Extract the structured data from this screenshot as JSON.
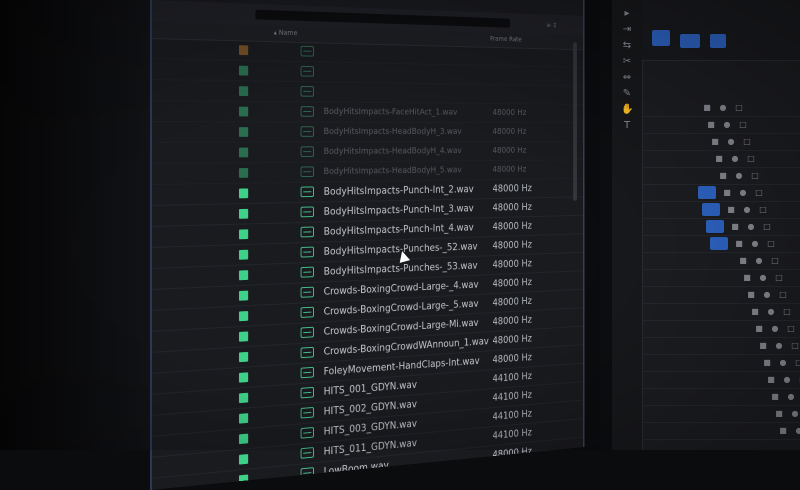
{
  "project_panel": {
    "sort_label": "≡ ↕",
    "header": {
      "name": "▴ Name",
      "rate": "Frame Rate"
    },
    "rows": [
      {
        "name": "",
        "rate": "",
        "dim": true
      },
      {
        "name": "",
        "rate": "",
        "dim": true
      },
      {
        "name": "",
        "rate": "",
        "dim": true
      },
      {
        "name": "BodyHitsImpacts-FaceHitAct_1.wav",
        "rate": "48000 Hz",
        "dim": true
      },
      {
        "name": "BodyHitsImpacts-HeadBodyH_3.wav",
        "rate": "48000 Hz",
        "dim": true
      },
      {
        "name": "BodyHitsImpacts-HeadBodyH_4.wav",
        "rate": "48000 Hz",
        "dim": true
      },
      {
        "name": "BodyHitsImpacts-HeadBodyH_5.wav",
        "rate": "48000 Hz",
        "dim": true
      },
      {
        "name": "BodyHitsImpacts-Punch-Int_2.wav",
        "rate": "48000 Hz",
        "dim": false
      },
      {
        "name": "BodyHitsImpacts-Punch-Int_3.wav",
        "rate": "48000 Hz",
        "dim": false
      },
      {
        "name": "BodyHitsImpacts-Punch-Int_4.wav",
        "rate": "48000 Hz",
        "dim": false
      },
      {
        "name": "BodyHitsImpacts-Punches-_52.wav",
        "rate": "48000 Hz",
        "dim": false
      },
      {
        "name": "BodyHitsImpacts-Punches-_53.wav",
        "rate": "48000 Hz",
        "dim": false
      },
      {
        "name": "Crowds-BoxingCrowd-Large-_4.wav",
        "rate": "48000 Hz",
        "dim": false
      },
      {
        "name": "Crowds-BoxingCrowd-Large-_5.wav",
        "rate": "48000 Hz",
        "dim": false
      },
      {
        "name": "Crowds-BoxingCrowd-Large-Mi.wav",
        "rate": "48000 Hz",
        "dim": false
      },
      {
        "name": "Crowds-BoxingCrowdWAnnoun_1.wav",
        "rate": "48000 Hz",
        "dim": false
      },
      {
        "name": "FoleyMovement-HandClaps-Int.wav",
        "rate": "48000 Hz",
        "dim": false
      },
      {
        "name": "HITS_001_GDYN.wav",
        "rate": "44100 Hz",
        "dim": false
      },
      {
        "name": "HITS_002_GDYN.wav",
        "rate": "44100 Hz",
        "dim": false
      },
      {
        "name": "HITS_003_GDYN.wav",
        "rate": "44100 Hz",
        "dim": false
      },
      {
        "name": "HITS_011_GDYN.wav",
        "rate": "44100 Hz",
        "dim": false
      },
      {
        "name": "LowBoom.wav",
        "rate": "48000 Hz",
        "dim": false
      }
    ]
  },
  "colors": {
    "label_green": "#3fd08a",
    "label_orange": "#e0922f",
    "panel_border": "#2c3a58",
    "track_blue": "#2f66c8"
  },
  "tools": [
    "selection-icon",
    "track-select-icon",
    "ripple-edit-icon",
    "razor-icon",
    "slip-icon",
    "pen-icon",
    "hand-icon",
    "type-icon"
  ],
  "right_panel": {
    "seq_label_1": "",
    "seq_label_2": ""
  }
}
